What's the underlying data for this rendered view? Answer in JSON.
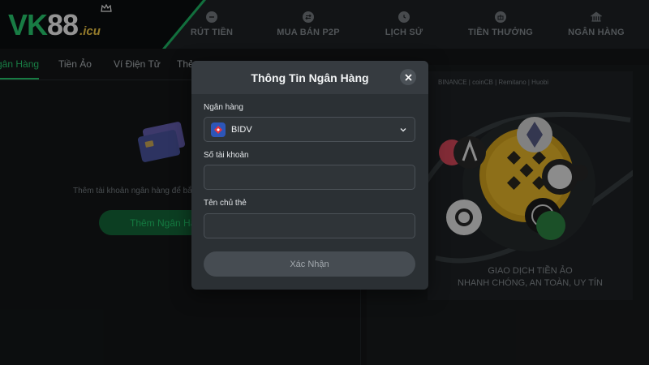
{
  "brand": {
    "logo_main": "VK",
    "logo_num": "88",
    "logo_tld": ".icu"
  },
  "nav": [
    {
      "label": "RÚT TIỀN",
      "icon": "minus-circle-icon"
    },
    {
      "label": "MUA BÁN P2P",
      "icon": "exchange-icon"
    },
    {
      "label": "LỊCH SỬ",
      "icon": "clock-icon"
    },
    {
      "label": "TIỀN THƯỞNG",
      "icon": "gift-icon"
    },
    {
      "label": "NGÂN HÀNG",
      "icon": "bank-icon"
    }
  ],
  "tabs": [
    {
      "label": "gân Hàng",
      "active": true
    },
    {
      "label": "Tiền Ảo",
      "active": false
    },
    {
      "label": "Ví Điện Tử",
      "active": false
    },
    {
      "label": "Thẻ",
      "active": false
    }
  ],
  "left_panel": {
    "empty_text": "Thêm tài khoản ngân hàng để bắt đầ",
    "add_button": "Thêm Ngân Hàng"
  },
  "promo": {
    "exchanges": "BINANCE | coinCB | Remitano | Huobi",
    "line1": "GIAO DỊCH TIỀN ẢO",
    "line2": "NHANH CHÓNG, AN TOÀN, UY TÍN"
  },
  "modal": {
    "title": "Thông Tin Ngân Hàng",
    "bank_label": "Ngân hàng",
    "bank_selected": "BIDV",
    "account_label": "Số tài khoản",
    "account_value": "",
    "holder_label": "Tên chủ thẻ",
    "holder_value": "",
    "confirm_label": "Xác Nhận"
  },
  "colors": {
    "accent": "#2ad676",
    "gold": "#ffd54a",
    "modal_bg": "#2b3034"
  }
}
